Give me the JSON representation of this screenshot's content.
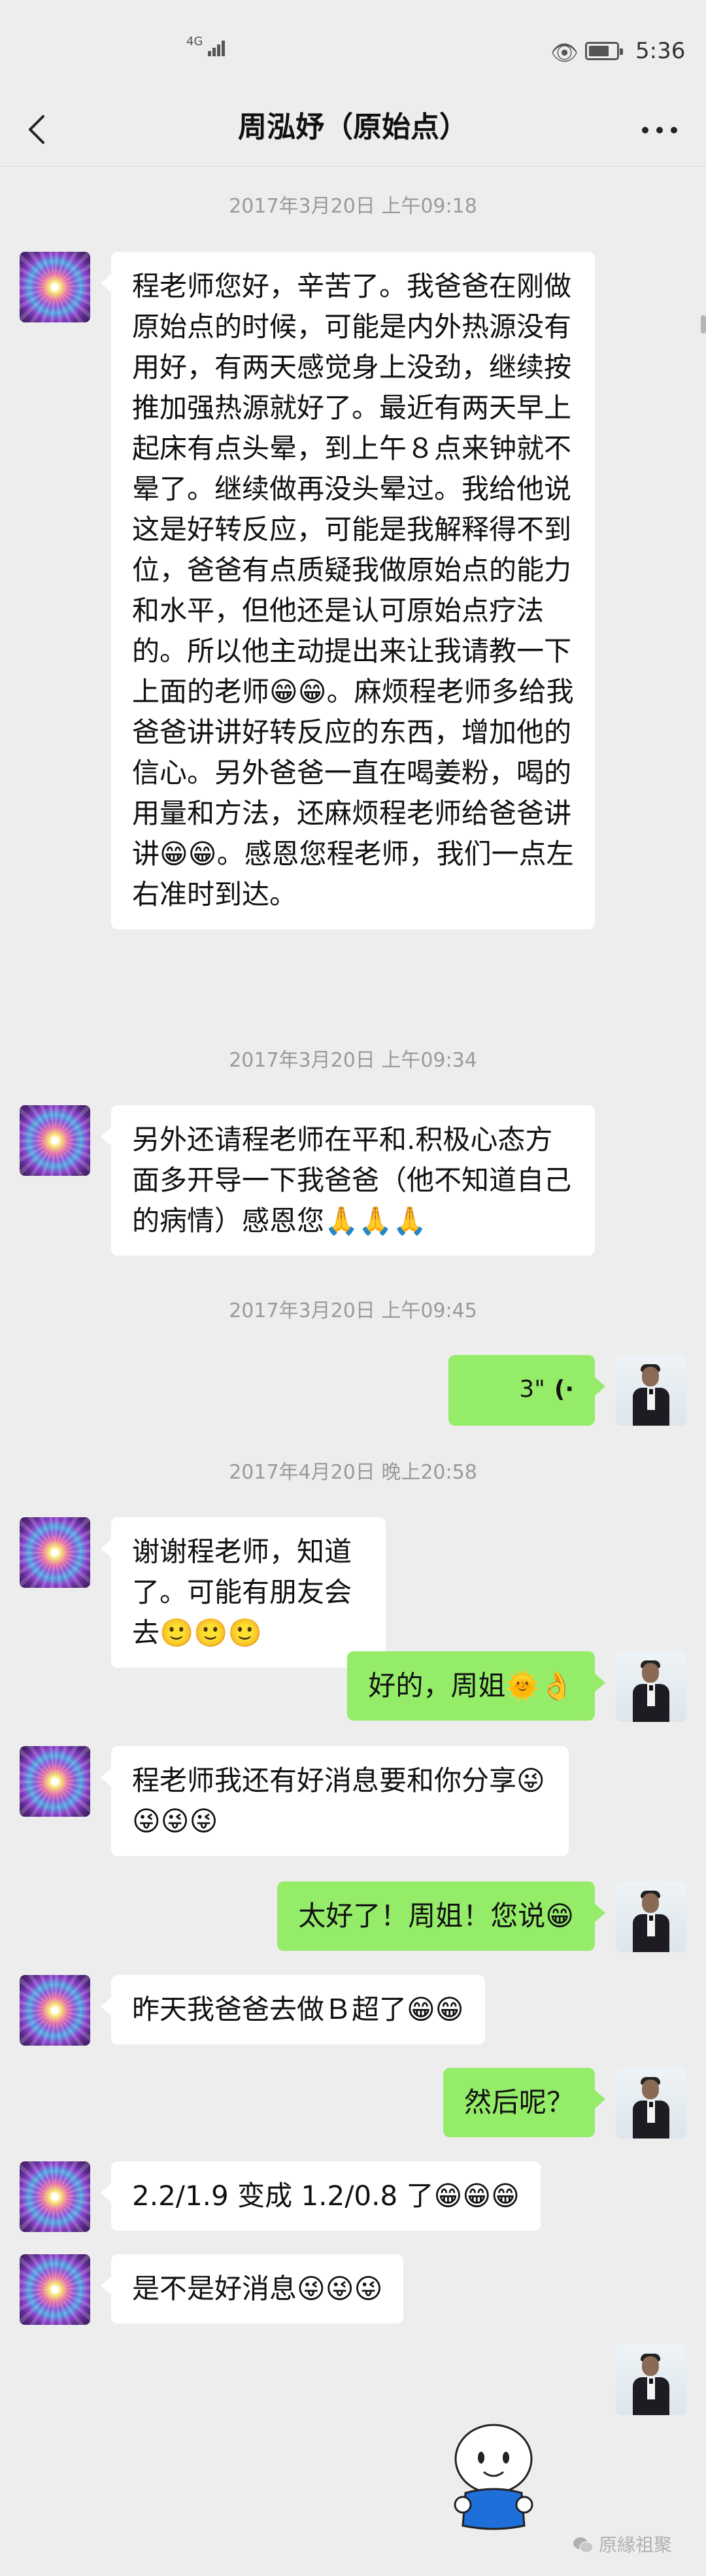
{
  "status_bar": {
    "network": "4G",
    "time": "5:36",
    "battery_level": 0.75
  },
  "header": {
    "title": "周泓妤（原始点）",
    "back_icon": "chevron-left-icon",
    "more_icon": "more-dots-icon"
  },
  "messages": {
    "ts1": "2017年3月20日 上午09:18",
    "m1": "程老师您好，辛苦了。我爸爸在刚做原始点的时候，可能是内外热源没有用好，有两天感觉身上没劲，继续按推加强热源就好了。最近有两天早上起床有点头晕，到上午８点来钟就不晕了。继续做再没头晕过。我给他说这是好转反应，可能是我解释得不到位，爸爸有点质疑我做原始点的能力和水平，但他还是认可原始点疗法的。所以他主动提出来让我请教一下上面的老师😁😁。麻烦程老师多给我爸爸讲讲好转反应的东西，增加他的信心。另外爸爸一直在喝姜粉，喝的用量和方法，还麻烦程老师给爸爸讲讲😁😁。感恩您程老师，我们一点左右准时到达。",
    "ts2": "2017年3月20日 上午09:34",
    "m2": "另外还请程老师在平和.积极心态方面多开导一下我爸爸（他不知道自己的病情）感恩您🙏🙏🙏",
    "ts3": "2017年3月20日 上午09:45",
    "voice_duration": "3\"",
    "ts4": "2017年4月20日 晚上20:58",
    "m3": "谢谢程老师，知道了。可能有朋友会去🙂🙂🙂",
    "m4": "好的，周姐🌞👌",
    "m5": "程老师我还有好消息要和你分享😜😜😜😜",
    "m6": "太好了！周姐！您说😁",
    "m7": "昨天我爸爸去做Ｂ超了😁😁",
    "m8": "然后呢？",
    "m9": "2.2/1.9 变成 1.2/0.8 了😁😁😁",
    "m10": "是不是好消息😜😜😜"
  },
  "watermark": {
    "text": "原緣祖聚"
  },
  "colors": {
    "background": "#ededed",
    "bubble_me": "#95ec69",
    "bubble_them": "#ffffff",
    "timestamp": "#9a9a9a"
  }
}
